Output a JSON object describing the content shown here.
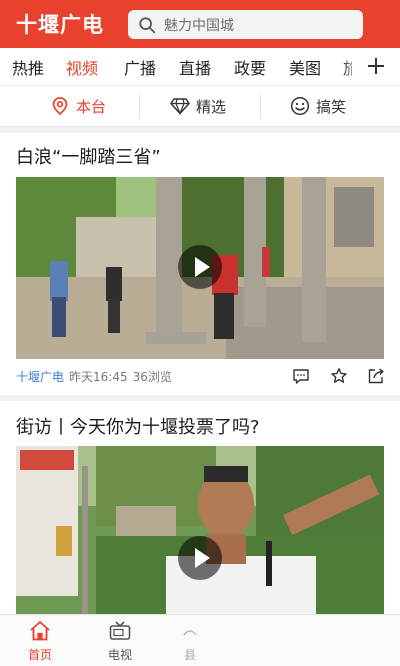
{
  "header": {
    "logo_text": "十堰广电",
    "search_placeholder": "魅力中国城"
  },
  "categories": [
    {
      "label": "热推",
      "active": false
    },
    {
      "label": "视频",
      "active": true
    },
    {
      "label": "广播",
      "active": false
    },
    {
      "label": "直播",
      "active": false
    },
    {
      "label": "政要",
      "active": false
    },
    {
      "label": "美图",
      "active": false
    },
    {
      "label": "旅",
      "active": false
    }
  ],
  "subtabs": [
    {
      "label": "本台",
      "icon": "location-pin-icon",
      "active": true
    },
    {
      "label": "精选",
      "icon": "diamond-icon",
      "active": false
    },
    {
      "label": "搞笑",
      "icon": "smiley-icon",
      "active": false
    }
  ],
  "articles": [
    {
      "title": "白浪“一脚踏三省”",
      "source": "十堰广电",
      "time": "昨天16:45",
      "views": "36浏览"
    },
    {
      "title": "街访丨今天你为十堰投票了吗?"
    }
  ],
  "bottom_nav": [
    {
      "label": "首页",
      "icon": "home-icon",
      "active": true
    },
    {
      "label": "电视",
      "icon": "tv-icon",
      "active": false
    },
    {
      "label": "县",
      "icon": "county-icon",
      "active": false
    }
  ],
  "colors": {
    "brand": "#e8412d",
    "source_link": "#3a7bd5"
  }
}
